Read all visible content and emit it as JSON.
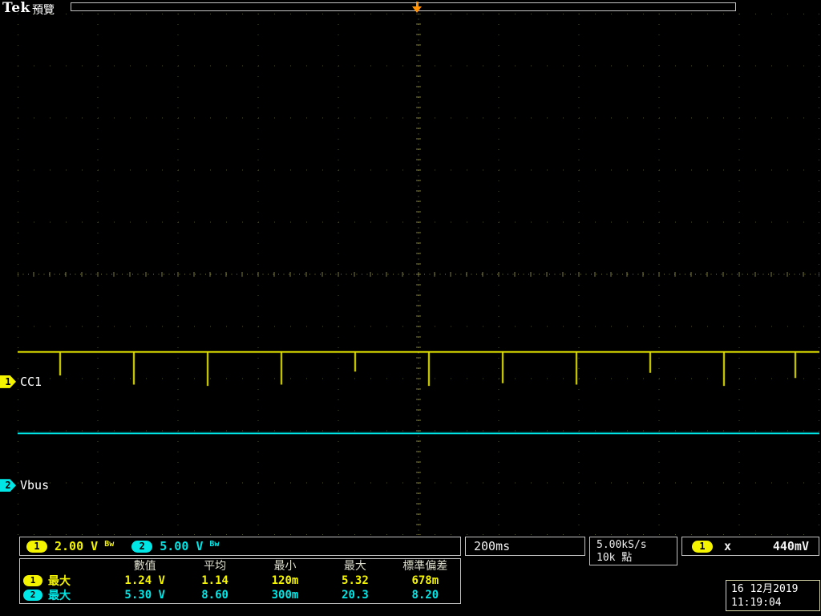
{
  "colors": {
    "ch1": "#f4f400",
    "ch2": "#00e6e6",
    "grid": "#50502a",
    "grid_center": "#7d7d3a",
    "orange": "#ff9100",
    "border": "#c4c4c4",
    "text": "#f0f0f0"
  },
  "header": {
    "brand": "Tek",
    "mode_label": "預覽"
  },
  "channel_markers": [
    {
      "num": "1",
      "label": "CC1"
    },
    {
      "num": "2",
      "label": "Vbus"
    }
  ],
  "status_bar": {
    "ch1": {
      "num": "1",
      "scale": "2.00 V",
      "bw": "Bw"
    },
    "ch2": {
      "num": "2",
      "scale": "5.00 V",
      "bw": "Bw"
    },
    "timebase": "200ms",
    "sample_rate": "5.00kS/s",
    "record_length": "10k 點",
    "trigger": {
      "source": "1",
      "symbol": "x",
      "level": "440mV"
    }
  },
  "measurements": {
    "headers": [
      "數值",
      "平均",
      "最小",
      "最大",
      "標準偏差"
    ],
    "rows": [
      {
        "ch": "1",
        "label": "最大",
        "values": [
          "1.24 V",
          "1.14",
          "120m",
          "5.32",
          "678m"
        ]
      },
      {
        "ch": "2",
        "label": "最大",
        "values": [
          "5.30 V",
          "8.60",
          "300m",
          "20.3",
          "8.20"
        ]
      }
    ]
  },
  "datetime": {
    "date": "16 12月2019",
    "time": "11:19:04"
  },
  "chart_data": {
    "type": "line",
    "title": "USB CC1 / Vbus capture",
    "time_per_div": "200ms",
    "divisions_x": 10,
    "divisions_y": 10,
    "series": [
      {
        "name": "CC1",
        "color": "#f4f400",
        "volts_per_div": 2.0,
        "zero_div_from_top": 7.06,
        "level_V": 1.14,
        "spikes_div_x": [
          0.53,
          1.45,
          2.37,
          3.29,
          4.21,
          5.13,
          6.05,
          6.97,
          7.89,
          8.81,
          9.7
        ],
        "spike_depths_V": [
          0.9,
          1.25,
          1.3,
          1.25,
          0.75,
          1.3,
          1.2,
          1.25,
          0.8,
          1.3,
          1.0
        ]
      },
      {
        "name": "Vbus",
        "color": "#00e6e6",
        "volts_per_div": 5.0,
        "zero_div_from_top": 9.05,
        "level_V": 5.0,
        "noise_V": 0.15
      }
    ]
  }
}
